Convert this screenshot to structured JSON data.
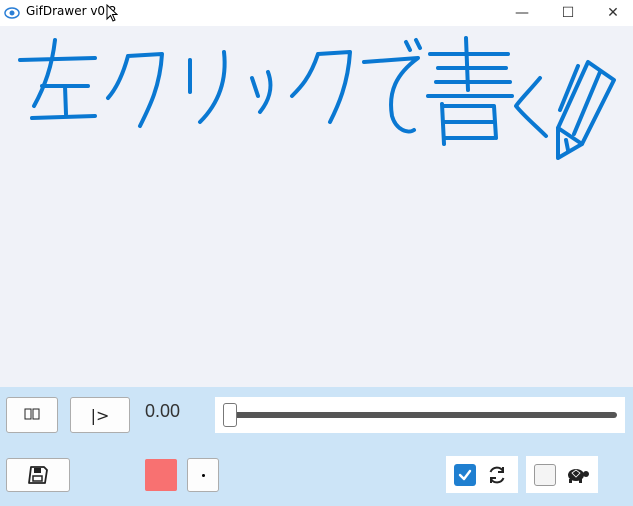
{
  "window": {
    "title": "GifDrawer v0.2",
    "controls": {
      "minimize": "—",
      "maximize": "☐",
      "close": "✕"
    }
  },
  "canvas": {
    "handwritten_text": "左クリックで書く",
    "ink_color": "#0a78d2",
    "icon": "pencil-icon"
  },
  "playback": {
    "frames_label": "⃞⃞",
    "play_label": "|>",
    "time": "0.00",
    "position": 0
  },
  "tools": {
    "save_icon": "floppy-disk-icon",
    "pen_color": "#f87171",
    "pen_size_icon": "dot-icon",
    "loop_checked": true,
    "loop_icon": "refresh-icon",
    "slow_checked": false,
    "slow_icon": "turtle-icon"
  }
}
